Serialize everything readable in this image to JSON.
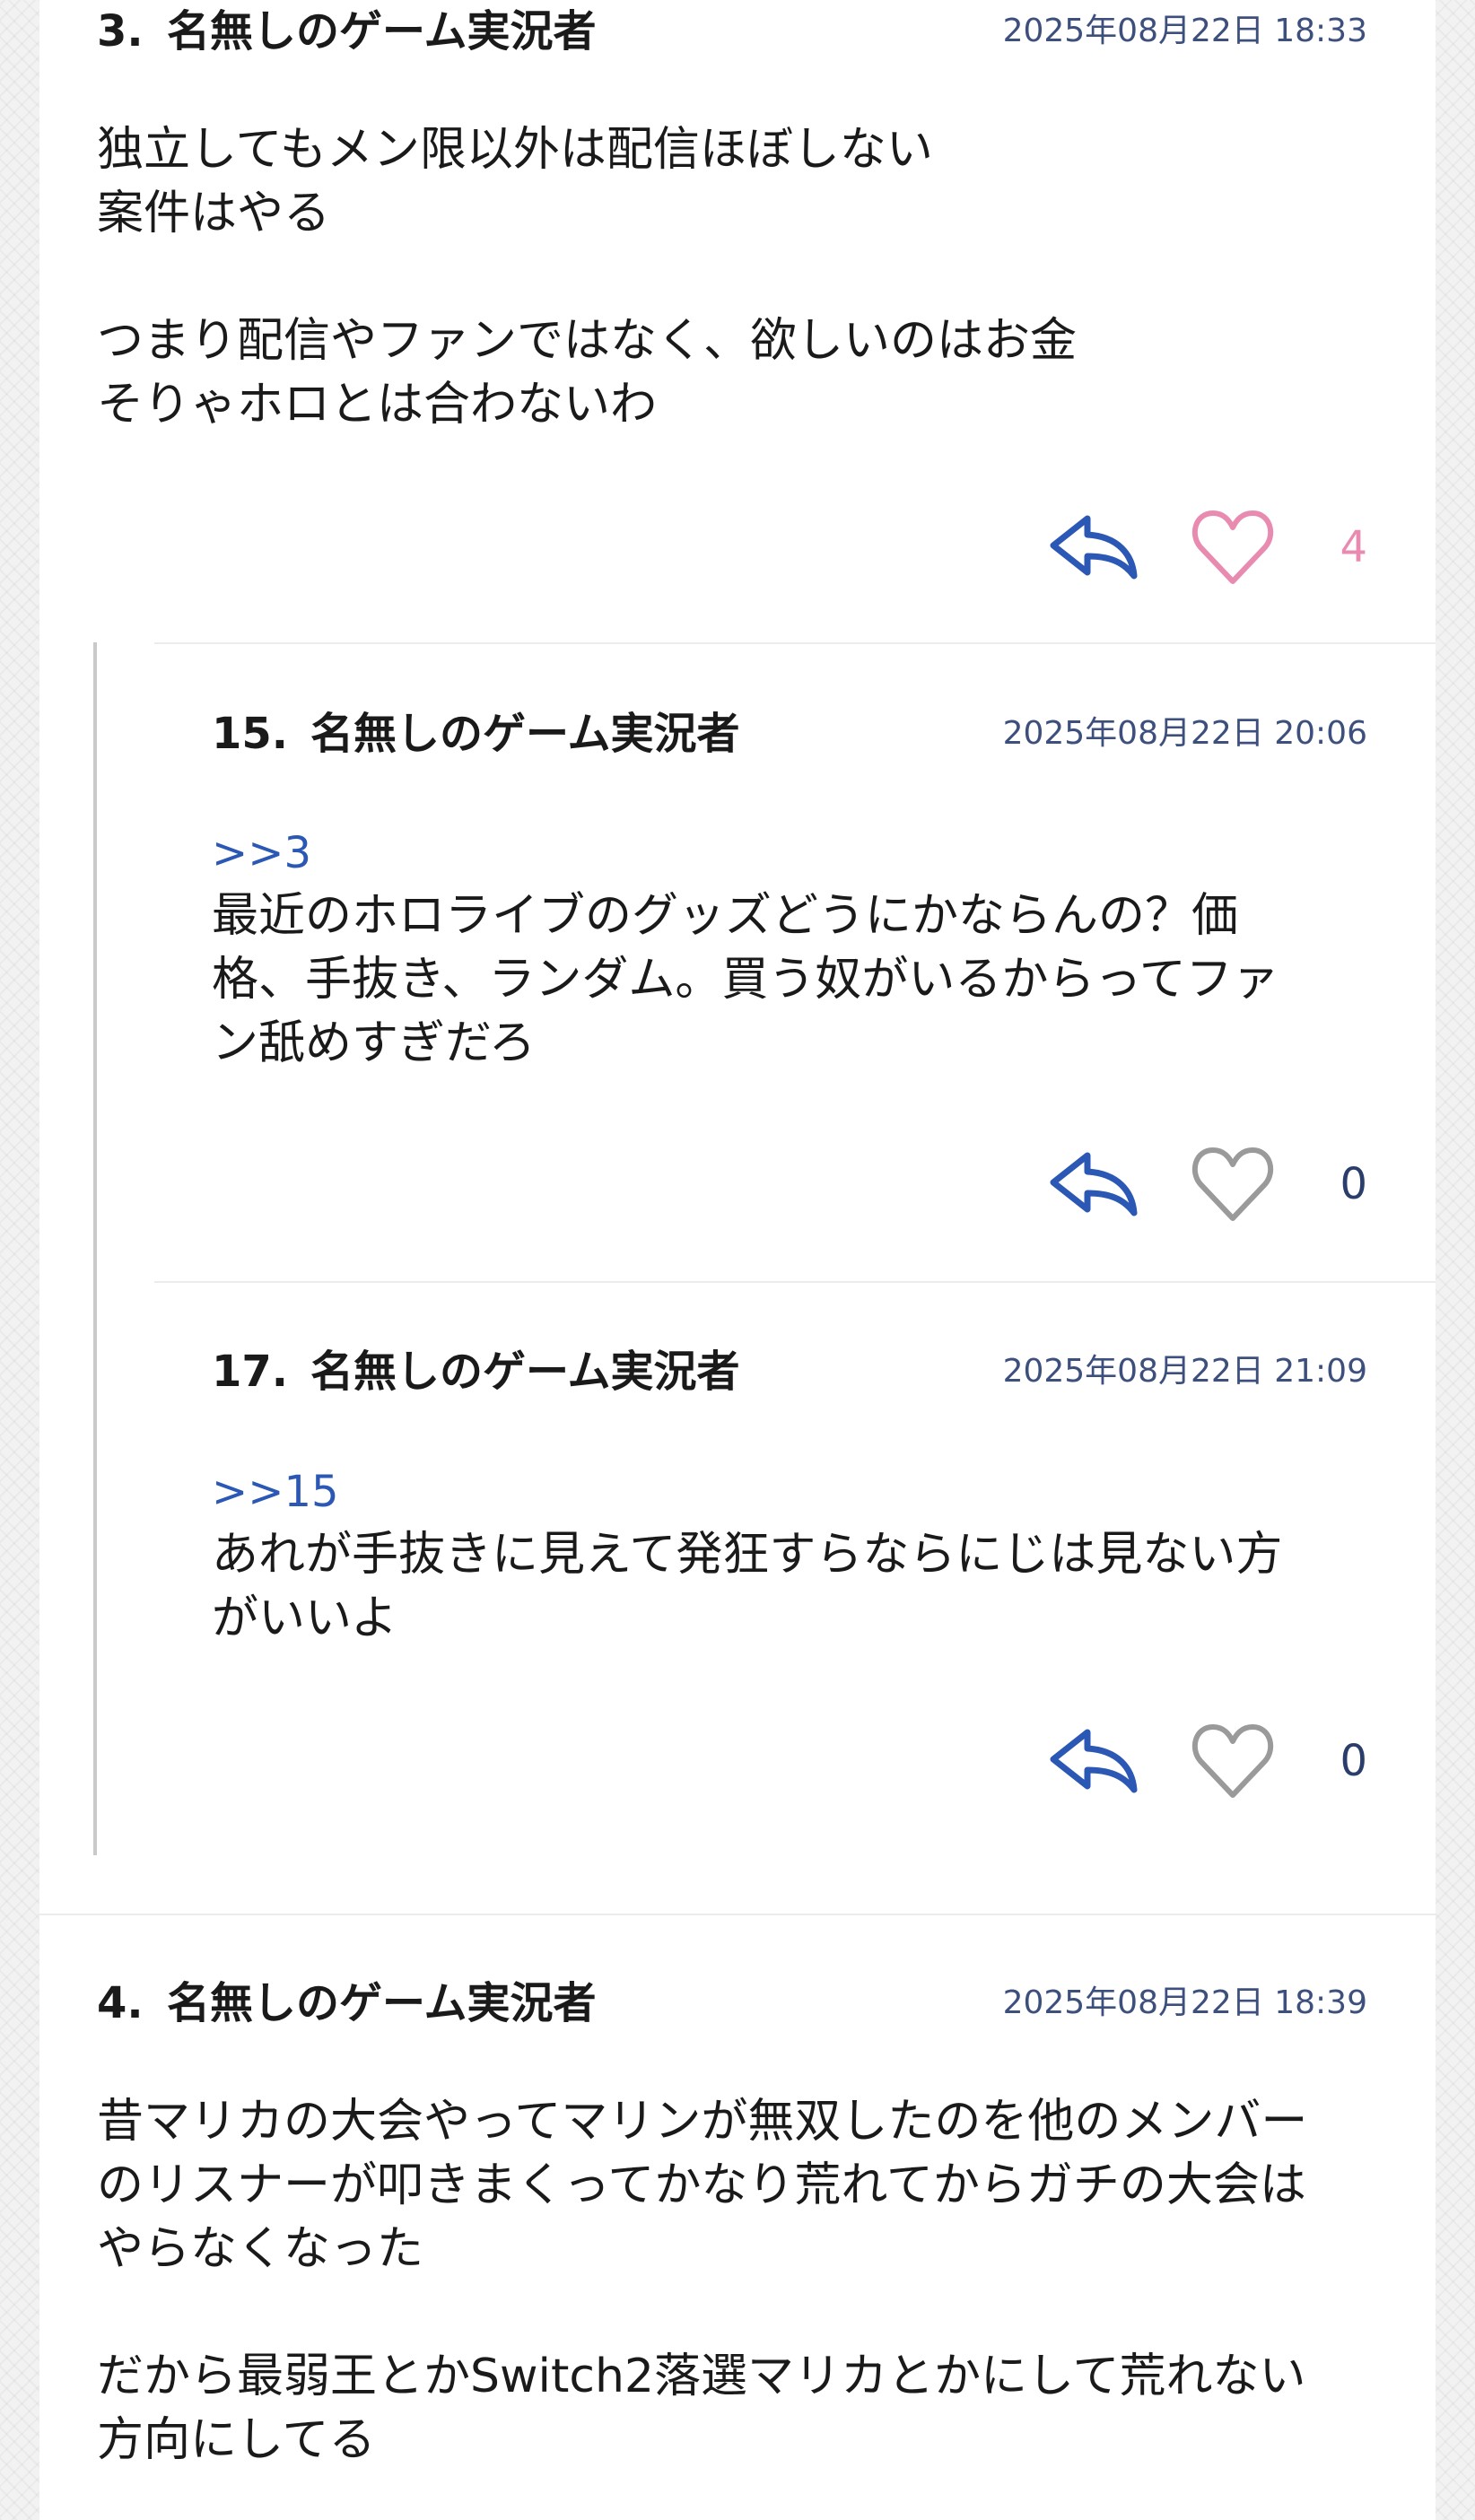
{
  "colors": {
    "accent_blue": "#2b58b4",
    "date_blue": "#3d4f7c",
    "like_pink": "#e98bb0",
    "like_gray": "#9a9a9a"
  },
  "comments": [
    {
      "number": "3.",
      "name": "名無しのゲーム実況者",
      "date": "2025年08月22日 18:33",
      "body": "独立してもメン限以外は配信ほぼしない\n案件はやる\n\nつまり配信やファンではなく、欲しいのはお金\nそりゃホロとは合わないわ",
      "likes": "4",
      "liked": true
    },
    {
      "number": "15.",
      "name": "名無しのゲーム実況者",
      "date": "2025年08月22日 20:06",
      "anchor": ">>3",
      "body": "最近のホロライブのグッズどうにかならんの？価\n格、手抜き、ランダム。買う奴がいるからってファ\nン舐めすぎだろ",
      "likes": "0",
      "liked": false
    },
    {
      "number": "17.",
      "name": "名無しのゲーム実況者",
      "date": "2025年08月22日 21:09",
      "anchor": ">>15",
      "body": "あれが手抜きに見えて発狂すらならにじは見ない方\nがいいよ",
      "likes": "0",
      "liked": false
    },
    {
      "number": "4.",
      "name": "名無しのゲーム実況者",
      "date": "2025年08月22日 18:39",
      "body": "昔マリカの大会やってマリンが無双したのを他のメンバー\nのリスナーが叩きまくってかなり荒れてからガチの大会は\nやらなくなった\n\nだから最弱王とかSwitch2落選マリカとかにして荒れない\n方向にしてる"
    }
  ]
}
